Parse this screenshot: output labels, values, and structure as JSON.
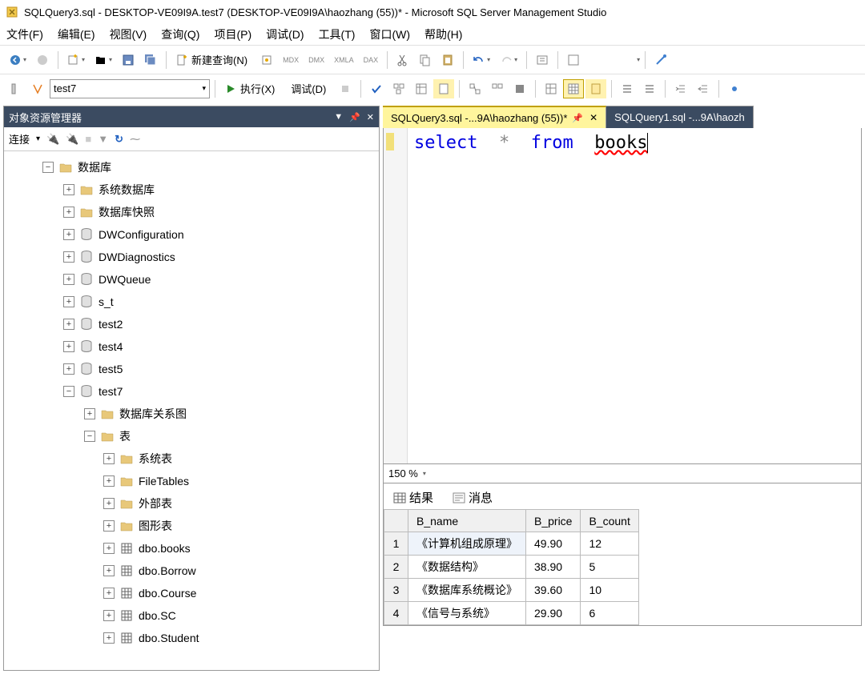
{
  "title": "SQLQuery3.sql - DESKTOP-VE09I9A.test7 (DESKTOP-VE09I9A\\haozhang (55))* - Microsoft SQL Server Management Studio",
  "menu": [
    "文件(F)",
    "编辑(E)",
    "视图(V)",
    "查询(Q)",
    "项目(P)",
    "调试(D)",
    "工具(T)",
    "窗口(W)",
    "帮助(H)"
  ],
  "toolbar": {
    "new_query": "新建查询(N)",
    "execute": "执行(X)",
    "debug": "调试(D)",
    "db_combo": "test7"
  },
  "explorer": {
    "title": "对象资源管理器",
    "connect_label": "连接",
    "root": "数据库",
    "sys_db": "系统数据库",
    "db_snapshot": "数据库快照",
    "dbs": [
      "DWConfiguration",
      "DWDiagnostics",
      "DWQueue",
      "s_t",
      "test2",
      "test4",
      "test5"
    ],
    "test7": "test7",
    "diagrams": "数据库关系图",
    "tables": "表",
    "sys_tables": "系统表",
    "file_tables": "FileTables",
    "ext_tables": "外部表",
    "graph_tables": "图形表",
    "user_tables": [
      "dbo.books",
      "dbo.Borrow",
      "dbo.Course",
      "dbo.SC",
      "dbo.Student"
    ]
  },
  "tabs": {
    "active": "SQLQuery3.sql -...9A\\haozhang (55))*",
    "other": "SQLQuery1.sql -...9A\\haozh"
  },
  "sql": {
    "select": "select",
    "star": "*",
    "from": "from",
    "table": "books"
  },
  "zoom": "150 %",
  "results": {
    "tab_results": "结果",
    "tab_messages": "消息",
    "columns": [
      "",
      "B_name",
      "B_price",
      "B_count"
    ],
    "rows": [
      [
        "1",
        "《计算机组成原理》",
        "49.90",
        "12"
      ],
      [
        "2",
        "《数据结构》",
        "38.90",
        "5"
      ],
      [
        "3",
        "《数据库系统概论》",
        "39.60",
        "10"
      ],
      [
        "4",
        "《信号与系统》",
        "29.90",
        "6"
      ]
    ]
  }
}
